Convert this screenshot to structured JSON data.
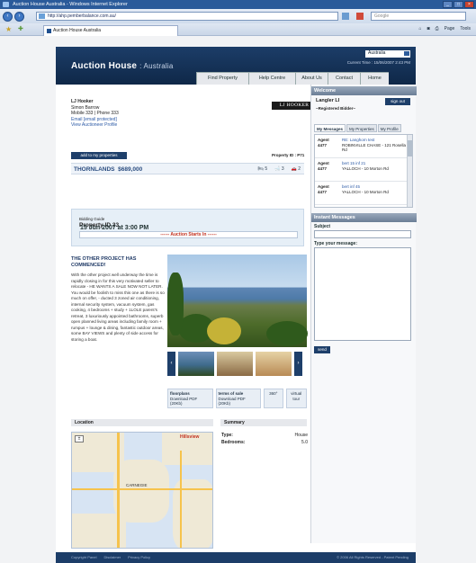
{
  "browser": {
    "title": "Auction House Australia - Windows Internet Explorer",
    "url": "http://ahp.pemberbalance.com.au/",
    "search_placeholder": "Google",
    "tab_label": "Auction House Australia",
    "tools": [
      "Page",
      "Tools"
    ]
  },
  "site": {
    "logo": "Auction House",
    "logo_sub": ": Australia",
    "region": "Australia",
    "current_time": "Current Time : 15/06/2007 2:43 PM",
    "nav": [
      "Find Property",
      "Help Centre",
      "About Us",
      "Contact",
      "Home"
    ]
  },
  "agent": {
    "name": "LJ Hooker",
    "contact": "Simon Barrow",
    "phones": "Mobile 333  |  Phone 333",
    "email": "Email [email protected]",
    "profile_link": "View Auctioneer Profile",
    "brand": "LJ HOOKER"
  },
  "property": {
    "add_button": "add to my properties",
    "id_label": "Property ID : P71",
    "address": "THORNLANDS",
    "price": "$689,000",
    "beds": "5",
    "baths": "3",
    "cars": "2"
  },
  "auction": {
    "bidding_guide": "Bidding Guide",
    "property_id": "Property ID 33",
    "starts_label": "------ Auction Starts In ------",
    "date": "15 Jun 2007 at 3:00 PM"
  },
  "description": {
    "title": "THE OTHER PROJECT HAS COMMENCED!",
    "text": "With the other project well underway the time is rapidly closing in for this very motivated seller to relocate - HE WANTS A SALE NOW NOT LATER. You would be foolish to miss this one as there is so much on offer, - ducted 3 zoned air conditioning, internal security system, vacuum system, gas cooking, 4 bedrooms + study + 1LOLE parent's retreat, 3 luxuriously appointed bathrooms, superb open planned living areas including family room + rumpus + lounge & dining, fantastic outdoor areas, some BAY VIEWS and plenty of side access for storing a boat."
  },
  "media": {
    "floorplans": "floorplans",
    "floorplans_sub": "Download PDF (20Kb)",
    "terms": "terms of sale",
    "terms_sub": "Download PDF (20Kb)",
    "tour_icon": "360°",
    "tour": "virtual tour"
  },
  "location": {
    "label": "Location",
    "map_labels": [
      "Hillsview",
      "CARNEGIE"
    ]
  },
  "summary": {
    "label": "Summary",
    "rows": [
      {
        "k": "Type:",
        "v": "House"
      },
      {
        "k": "Bedrooms:",
        "v": "5.0"
      }
    ]
  },
  "sidebar": {
    "welcome_header": "Welcome",
    "user": "Langler LI",
    "user_sub": "~Registered Bidder~",
    "signout": "sign out",
    "tabs": [
      "My Messages",
      "My Properties",
      "My Profile"
    ],
    "messages": [
      {
        "agent": "Agent 4477",
        "subject": "RE: Langhorn test",
        "body": "ROBINVILLE CHASE - 121 Rosella Rd"
      },
      {
        "agent": "Agent 4477",
        "subject": "bert 15 inf 21",
        "body": "YALLOCH - 10 Morton Rd"
      },
      {
        "agent": "Agent 4477",
        "subject": "bert inf 45",
        "body": "YALLOCH - 10 Morton Rd"
      }
    ],
    "im_header": "Instant Messages",
    "subject_label": "Subject",
    "message_label": "Type your message:",
    "send": "send"
  },
  "footer": {
    "links": [
      "Copyright Panel",
      "Disclaimer",
      "Privacy Policy"
    ],
    "right": "© 2006 All Rights Reserved - Patent Pending"
  }
}
